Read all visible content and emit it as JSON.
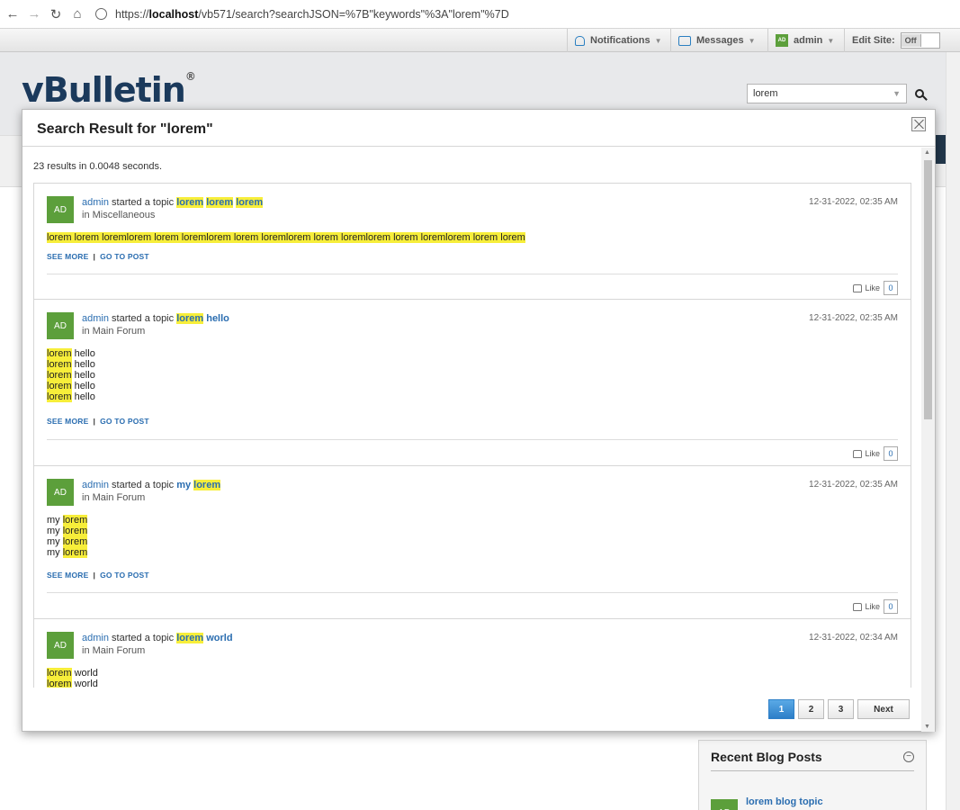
{
  "browser": {
    "url_scheme": "https://",
    "url_host": "localhost",
    "url_path": "/vb571/search?searchJSON=%7B\"keywords\"%3A\"lorem\"%7D"
  },
  "topbar": {
    "notifications": "Notifications",
    "messages": "Messages",
    "user": "admin",
    "user_initials": "AD",
    "edit_site_label": "Edit Site:",
    "edit_site_state": "Off"
  },
  "header": {
    "logo_text": "vBulletin",
    "logo_mark": "®",
    "search_value": "lorem"
  },
  "modal": {
    "title": "Search Result for \"lorem\"",
    "summary": "23 results in 0.0048 seconds.",
    "results": [
      {
        "initials": "AD",
        "author": "admin",
        "action": "started a topic",
        "topic_words": [
          "lorem",
          "lorem",
          "lorem"
        ],
        "in_label": "in",
        "forum": "Miscellaneous",
        "date": "12-31-2022, 02:35 AM",
        "body": "lorem lorem loremlorem lorem loremlorem lorem loremlorem lorem loremlorem lorem loremlorem lorem lorem",
        "see_more": "SEE MORE",
        "go_to_post": "GO TO POST",
        "like_label": "Like",
        "like_count": "0"
      },
      {
        "initials": "AD",
        "author": "admin",
        "action": "started a topic",
        "topic_hl": "lorem",
        "topic_rest": "hello",
        "in_label": "in",
        "forum": "Main Forum",
        "date": "12-31-2022, 02:35 AM",
        "body_lines": [
          {
            "hl": "lorem",
            "rest": " hello"
          },
          {
            "hl": "lorem",
            "rest": " hello"
          },
          {
            "hl": "lorem",
            "rest": " hello"
          },
          {
            "hl": "lorem",
            "rest": " hello"
          },
          {
            "hl": "lorem",
            "rest": " hello"
          }
        ],
        "see_more": "SEE MORE",
        "go_to_post": "GO TO POST",
        "like_label": "Like",
        "like_count": "0"
      },
      {
        "initials": "AD",
        "author": "admin",
        "action": "started a topic",
        "topic_pre": "my",
        "topic_hl": "lorem",
        "in_label": "in",
        "forum": "Main Forum",
        "date": "12-31-2022, 02:35 AM",
        "body_lines": [
          {
            "pre": "my ",
            "hl": "lorem"
          },
          {
            "pre": "my ",
            "hl": "lorem"
          },
          {
            "pre": "my ",
            "hl": "lorem"
          },
          {
            "pre": "my ",
            "hl": "lorem"
          }
        ],
        "see_more": "SEE MORE",
        "go_to_post": "GO TO POST",
        "like_label": "Like",
        "like_count": "0"
      },
      {
        "initials": "AD",
        "author": "admin",
        "action": "started a topic",
        "topic_hl": "lorem",
        "topic_rest": "world",
        "in_label": "in",
        "forum": "Main Forum",
        "date": "12-31-2022, 02:34 AM",
        "body_lines": [
          {
            "hl": "lorem",
            "rest": " world"
          },
          {
            "hl": "lorem",
            "rest": " world"
          }
        ]
      }
    ],
    "pagination": {
      "pages": [
        "1",
        "2",
        "3"
      ],
      "next": "Next"
    }
  },
  "sidebar": {
    "widget_title": "Recent Blog Posts",
    "widget_initials": "AD",
    "widget_link": "lorem blog topic"
  },
  "colors": {
    "highlight": "#f7ee3a",
    "link": "#2a6db0",
    "avatar": "#5c9f3b",
    "active_page": "#2d7fc8"
  }
}
